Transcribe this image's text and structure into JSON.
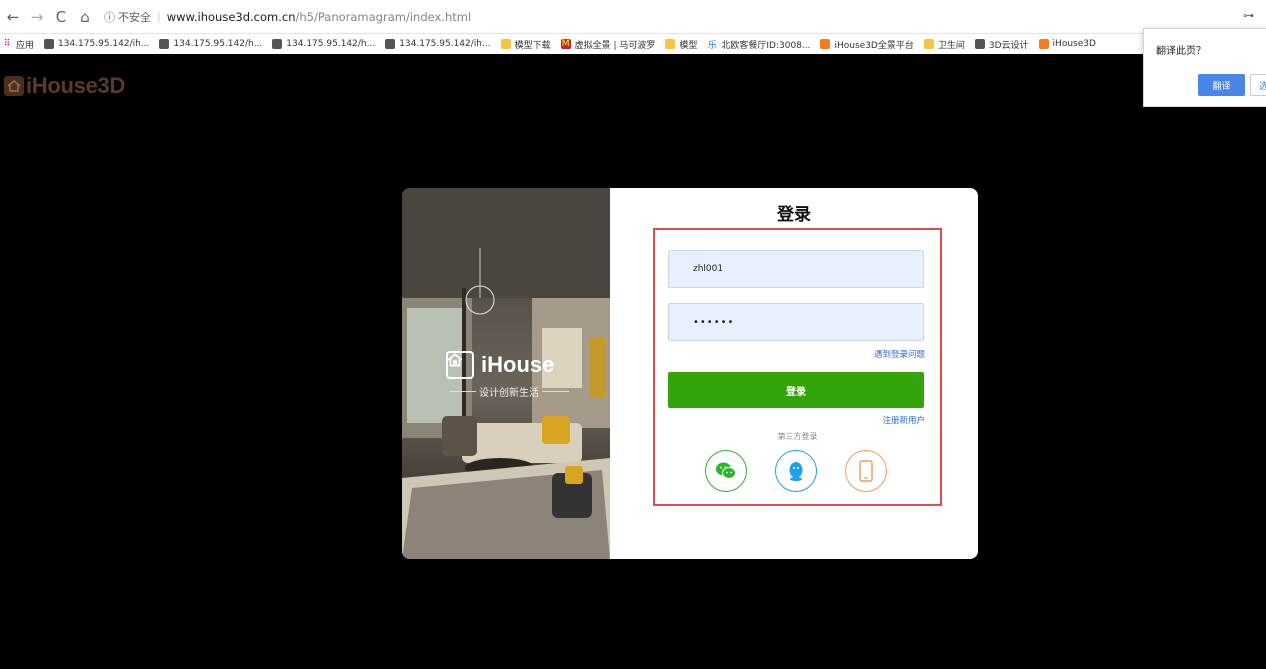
{
  "browser": {
    "security_label": "不安全",
    "url_host": "www.ihouse3d.com.cn",
    "url_path": "/h5/Panoramagram/index.html"
  },
  "bookmarks": [
    {
      "label": "应用",
      "icon": "apps-grid-icon"
    },
    {
      "label": "134.175.95.142/ih...",
      "icon": "globe-icon"
    },
    {
      "label": "134.175.95.142/h...",
      "icon": "globe-icon"
    },
    {
      "label": "134.175.95.142/h...",
      "icon": "globe-icon"
    },
    {
      "label": "134.175.95.142/ih...",
      "icon": "globe-icon"
    },
    {
      "label": "模型下载",
      "icon": "folder-icon"
    },
    {
      "label": "虚拟全景 | 马可波罗",
      "icon": "red-logo-icon"
    },
    {
      "label": "模型",
      "icon": "folder-icon"
    },
    {
      "label": "北欧客餐厅ID:3008...",
      "icon": "le-icon"
    },
    {
      "label": "iHouse3D全景平台",
      "icon": "orange-logo-icon"
    },
    {
      "label": "卫生间",
      "icon": "folder-icon"
    },
    {
      "label": "3D云设计",
      "icon": "globe-icon"
    },
    {
      "label": "iHouse3D",
      "icon": "orange-logo-icon"
    }
  ],
  "translate_popup": {
    "title": "翻译此页？",
    "translate_label": "翻译",
    "other_label": "选"
  },
  "site": {
    "logo_text": "iHouse3D"
  },
  "login_card": {
    "photo_logo": "iHouse",
    "slogan": "设计创新生活",
    "title": "登录",
    "username_value": "zhl001",
    "password_value": "••••••",
    "forgot_link": "遇到登录问题",
    "login_button": "登录",
    "register_link": "注册新用户",
    "third_party_label": "第三方登录",
    "social": [
      {
        "name": "wechat",
        "icon": "wechat-icon",
        "color": "#2bb52b"
      },
      {
        "name": "qq",
        "icon": "qq-penguin-icon",
        "color": "#1ea0f0"
      },
      {
        "name": "phone",
        "icon": "phone-icon",
        "color": "#f39a5a"
      }
    ]
  },
  "colors": {
    "login_button": "#33a50a",
    "highlight_border": "#e34a4a",
    "link": "#2a6de0",
    "input_bg": "#e8effd"
  }
}
